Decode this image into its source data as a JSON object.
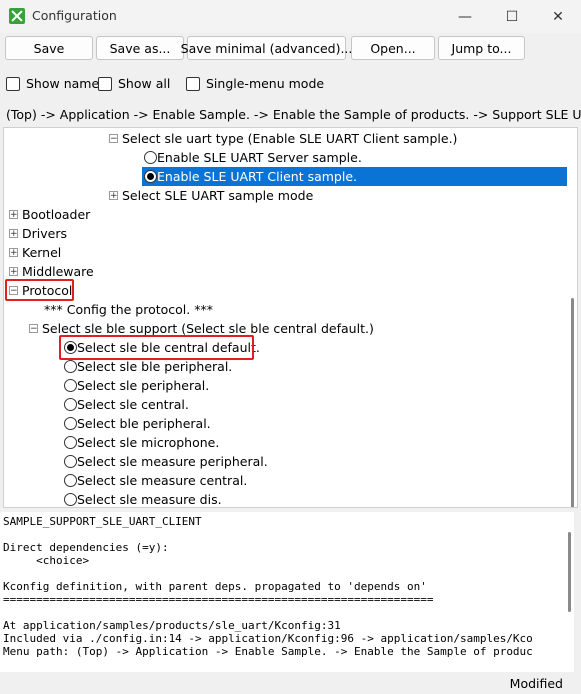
{
  "window": {
    "title": "Configuration",
    "minimize": "—",
    "maximize": "☐",
    "close": "✕"
  },
  "toolbar": {
    "save": "Save",
    "save_as": "Save as...",
    "save_minimal": "Save minimal (advanced)...",
    "open": "Open...",
    "jump_to": "Jump to..."
  },
  "options": {
    "show_name": "Show name",
    "show_all": "Show all",
    "single_menu": "Single-menu mode"
  },
  "path": "(Top) -> Application -> Enable Sample. -> Enable the Sample of products. -> Support SLE UART s",
  "tree": {
    "select_uart_type": "Select sle uart type (Enable SLE UART Client sample.)",
    "uart_server": "Enable SLE UART Server sample.",
    "uart_client": "Enable SLE UART Client sample.",
    "uart_mode": "Select SLE UART sample mode",
    "bootloader": "Bootloader",
    "drivers": "Drivers",
    "kernel": "Kernel",
    "middleware": "Middleware",
    "protocol": "Protocol",
    "config_protocol": "*** Config the protocol. ***",
    "ble_support": "Select sle ble support (Select sle ble central default.)",
    "radios": [
      "Select sle ble central default.",
      "Select sle ble peripheral.",
      "Select sle peripheral.",
      "Select sle central.",
      "Select ble peripheral.",
      "Select sle microphone.",
      "Select sle measure peripheral.",
      "Select sle measure central.",
      "Select sle measure dis."
    ],
    "expand_glyph": "+",
    "collapse_glyph": "−"
  },
  "info": {
    "symbol": "SAMPLE_SUPPORT_SLE_UART_CLIENT",
    "deps_title": "Direct dependencies (=y):",
    "deps_value": "     <choice>",
    "kconfig_def": "Kconfig definition, with parent deps. propagated to 'depends on'",
    "separator": "=================================================================",
    "at_line": "At application/samples/products/sle_uart/Kconfig:31",
    "included_via": "Included via ./config.in:14 -> application/Kconfig:96 -> application/samples/Kco",
    "menu_path": "Menu path: (Top) -> Application -> Enable Sample. -> Enable the Sample of produc"
  },
  "status": "Modified"
}
